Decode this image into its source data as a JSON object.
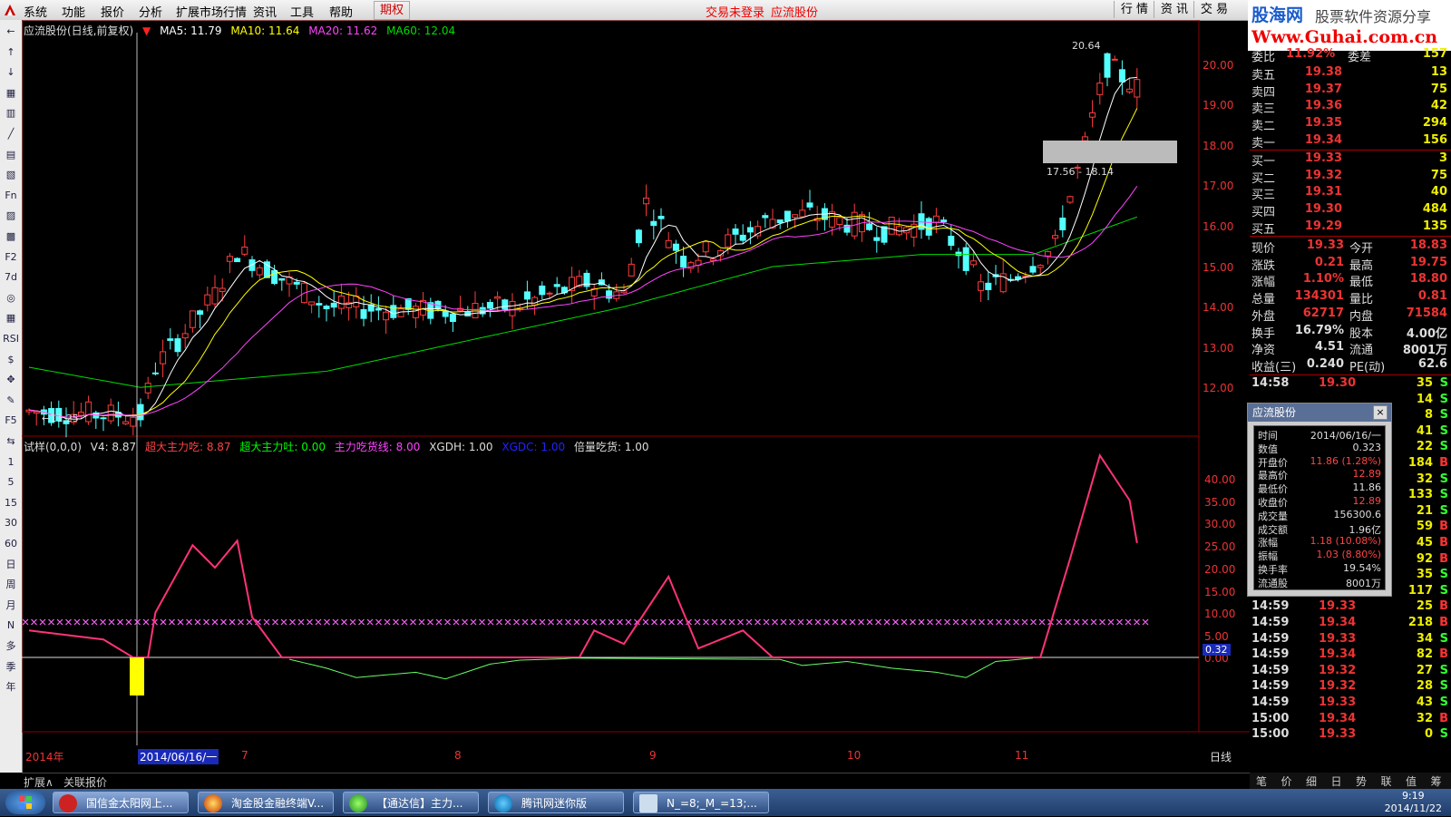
{
  "menu": {
    "items": [
      "系统",
      "功能",
      "报价",
      "分析",
      "扩展市场行情",
      "资讯",
      "工具",
      "帮助"
    ],
    "period": "期权",
    "status_login": "交易未登录",
    "status_stock": "应流股份",
    "right_tabs": [
      "行 情",
      "资 讯",
      "交 易"
    ]
  },
  "brand": {
    "name": "股海网",
    "slogan": "股票软件资源分享",
    "url": "Www.Guhai.com.cn"
  },
  "toolbar": [
    "←",
    "↑",
    "↓",
    "▦",
    "▥",
    "╱",
    "▤",
    "▧",
    "Fn",
    "▨",
    "▩",
    "F2",
    "7d",
    "◎",
    "▦",
    "RSI",
    "$",
    "✥",
    "✎",
    "F5",
    "⇆",
    "1",
    "5",
    "15",
    "30",
    "60",
    "日",
    "周",
    "月",
    "N",
    "多",
    "季",
    "年"
  ],
  "main_chart": {
    "title": "应流股份(日线,前复权)",
    "ma5": "MA5: 11.79",
    "ma10": "MA10: 11.64",
    "ma20": "MA20: 11.62",
    "ma60": "MA60: 12.04",
    "high_label": "20.64",
    "low_label": "←11.25",
    "range_label": "17.56 - 18.14",
    "y_labels": [
      "20.00",
      "19.00",
      "18.00",
      "17.00",
      "16.00",
      "15.00",
      "14.00",
      "13.00",
      "12.00"
    ],
    "colors": {
      "up": "#ff3c3c",
      "down": "#54ffff",
      "ma5": "#ffffff",
      "ma10": "#ffff00",
      "ma20": "#ff44ff",
      "ma60": "#00dd00"
    }
  },
  "indicator": {
    "name": "试样(0,0,0)",
    "v4": "V4: 8.87",
    "chao_chi": "超大主力吃: 8.87",
    "chao_tu": "超大主力吐: 0.00",
    "main_line": "主力吃货线: 8.00",
    "xgdh": "XGDH: 1.00",
    "xgdc": "XGDC: 1.00",
    "beiliang": "倍量吃货: 1.00",
    "y_labels": [
      "40.00",
      "35.00",
      "30.00",
      "25.00",
      "20.00",
      "15.00",
      "10.00",
      "5.00",
      "0.00"
    ],
    "current_value": "0.32"
  },
  "x_axis": {
    "labels": [
      "2014年",
      "2014/06/16/一",
      "7",
      "8",
      "9",
      "10",
      "11"
    ],
    "period": "日线"
  },
  "quote": {
    "weibi": {
      "label": "委比",
      "value": "11.92%",
      "label2": "委差",
      "value2": "157"
    },
    "asks": [
      {
        "label": "卖五",
        "price": "19.38",
        "vol": "13"
      },
      {
        "label": "卖四",
        "price": "19.37",
        "vol": "75"
      },
      {
        "label": "卖三",
        "price": "19.36",
        "vol": "42"
      },
      {
        "label": "卖二",
        "price": "19.35",
        "vol": "294"
      },
      {
        "label": "卖一",
        "price": "19.34",
        "vol": "156"
      }
    ],
    "bids": [
      {
        "label": "买一",
        "price": "19.33",
        "vol": "3"
      },
      {
        "label": "买二",
        "price": "19.32",
        "vol": "75"
      },
      {
        "label": "买三",
        "price": "19.31",
        "vol": "40"
      },
      {
        "label": "买四",
        "price": "19.30",
        "vol": "484"
      },
      {
        "label": "买五",
        "price": "19.29",
        "vol": "135"
      }
    ],
    "stats": [
      {
        "l1": "现价",
        "v1": "19.33",
        "l2": "今开",
        "v2": "18.83"
      },
      {
        "l1": "涨跌",
        "v1": "0.21",
        "l2": "最高",
        "v2": "19.75"
      },
      {
        "l1": "涨幅",
        "v1": "1.10%",
        "l2": "最低",
        "v2": "18.80"
      },
      {
        "l1": "总量",
        "v1": "134301",
        "l2": "量比",
        "v2": "0.81"
      },
      {
        "l1": "外盘",
        "v1": "62717",
        "l2": "内盘",
        "v2": "71584"
      },
      {
        "l1": "换手",
        "v1": "16.79%",
        "l2": "股本",
        "v2": "4.00亿"
      },
      {
        "l1": "净资",
        "v1": "4.51",
        "l2": "流通",
        "v2": "8001万"
      },
      {
        "l1": "收益(三)",
        "v1": "0.240",
        "l2": "PE(动)",
        "v2": "62.6"
      }
    ],
    "ticks": [
      {
        "t": "14:58",
        "p": "19.30",
        "v": "35",
        "s": "S"
      },
      {
        "t": "",
        "p": "",
        "v": "14",
        "s": "S"
      },
      {
        "t": "",
        "p": "",
        "v": "8",
        "s": "S"
      },
      {
        "t": "",
        "p": "",
        "v": "41",
        "s": "S"
      },
      {
        "t": "",
        "p": "",
        "v": "22",
        "s": "S"
      },
      {
        "t": "",
        "p": "",
        "v": "184",
        "s": "B"
      },
      {
        "t": "",
        "p": "",
        "v": "32",
        "s": "S"
      },
      {
        "t": "",
        "p": "",
        "v": "133",
        "s": "S"
      },
      {
        "t": "",
        "p": "",
        "v": "21",
        "s": "S"
      },
      {
        "t": "",
        "p": "",
        "v": "59",
        "s": "B"
      },
      {
        "t": "",
        "p": "",
        "v": "45",
        "s": "B"
      },
      {
        "t": "",
        "p": "",
        "v": "92",
        "s": "B"
      },
      {
        "t": "",
        "p": "",
        "v": "35",
        "s": "S"
      },
      {
        "t": "14:59",
        "p": "19.32",
        "v": "117",
        "s": "S"
      },
      {
        "t": "14:59",
        "p": "19.33",
        "v": "25",
        "s": "B"
      },
      {
        "t": "14:59",
        "p": "19.34",
        "v": "218",
        "s": "B"
      },
      {
        "t": "14:59",
        "p": "19.33",
        "v": "34",
        "s": "S"
      },
      {
        "t": "14:59",
        "p": "19.34",
        "v": "82",
        "s": "B"
      },
      {
        "t": "14:59",
        "p": "19.32",
        "v": "27",
        "s": "S"
      },
      {
        "t": "14:59",
        "p": "19.32",
        "v": "28",
        "s": "S"
      },
      {
        "t": "14:59",
        "p": "19.33",
        "v": "43",
        "s": "S"
      },
      {
        "t": "15:00",
        "p": "19.34",
        "v": "32",
        "s": "B"
      },
      {
        "t": "15:00",
        "p": "19.33",
        "v": "0",
        "s": "S"
      }
    ]
  },
  "popup": {
    "title": "应流股份",
    "close": "×",
    "rows": [
      {
        "k": "时间",
        "v": "2014/06/16/一"
      },
      {
        "k": "数值",
        "v": "0.323"
      },
      {
        "k": "开盘价",
        "v": "11.86 (1.28%)"
      },
      {
        "k": "最高价",
        "v": "12.89"
      },
      {
        "k": "最低价",
        "v": "11.86"
      },
      {
        "k": "收盘价",
        "v": "12.89"
      },
      {
        "k": "成交量",
        "v": "156300.6"
      },
      {
        "k": "成交额",
        "v": "1.96亿"
      },
      {
        "k": "涨幅",
        "v": "1.18 (10.08%)"
      },
      {
        "k": "振幅",
        "v": "1.03 (8.80%)"
      },
      {
        "k": "换手率",
        "v": "19.54%"
      },
      {
        "k": "流通股",
        "v": "8001万"
      }
    ]
  },
  "bottom_tabs": [
    "扩展∧",
    "关联报价"
  ],
  "quote_tabs": [
    "笔",
    "价",
    "细",
    "日",
    "势",
    "联",
    "值",
    "筹"
  ],
  "taskbar": {
    "tasks": [
      "国信金太阳网上...",
      "淘金股金融终端V...",
      "【通达信】主力...",
      "腾讯网迷你版",
      "N_=8;_M_=13;..."
    ],
    "time": "9:19",
    "date": "2014/11/22"
  }
}
